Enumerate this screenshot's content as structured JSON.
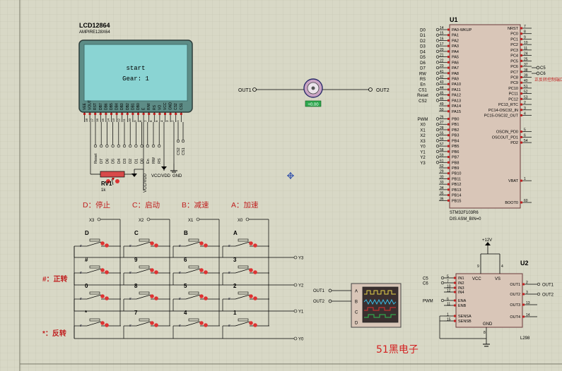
{
  "lcd": {
    "title": "LCD12864",
    "model": "AMPIRE128X64",
    "line1": "start",
    "line2": "Gear: 1",
    "pin_labels": [
      "VEE",
      "VOUT",
      "RST",
      "DB7",
      "DB6",
      "DB5",
      "DB4",
      "DB3",
      "DB2",
      "DB1",
      "DB0",
      "E",
      "R/W",
      "RS",
      "VO",
      "VCC",
      "GND",
      "CS2",
      "CS1"
    ],
    "pin_numbers": [
      "18",
      "17",
      "16",
      "15",
      "14",
      "13",
      "12",
      "11",
      "10",
      "9",
      "8",
      "7",
      "6",
      "5",
      "4",
      "3",
      "2",
      "1"
    ],
    "net_labels": [
      "Reset",
      "D7",
      "D6",
      "D5",
      "D4",
      "D3",
      "D2",
      "D1",
      "D0",
      "En",
      "RW",
      "RS"
    ],
    "cs_labels": [
      "CS2",
      "CS1"
    ],
    "pot_ref": "RV1",
    "pot_value": "1k",
    "power_label": "VCC/VDD",
    "gnd_label": "GND",
    "vcc_label": "VCC/VDD"
  },
  "motor": {
    "left_label": "OUT1",
    "right_label": "OUT2",
    "badge": "+0.00"
  },
  "mcu": {
    "ref": "U1",
    "part": "STM32F103R6",
    "program": "DIS ASM_BIN=0",
    "left_pins": [
      {
        "net": "D0",
        "num": "14",
        "name": "PA0-WKUP"
      },
      {
        "net": "D1",
        "num": "15",
        "name": "PA1"
      },
      {
        "net": "D2",
        "num": "16",
        "name": "PA2"
      },
      {
        "net": "D3",
        "num": "17",
        "name": "PA3"
      },
      {
        "net": "D4",
        "num": "20",
        "name": "PA4"
      },
      {
        "net": "D5",
        "num": "21",
        "name": "PA5"
      },
      {
        "net": "D6",
        "num": "22",
        "name": "PA6"
      },
      {
        "net": "D7",
        "num": "23",
        "name": "PA7"
      },
      {
        "net": "RW",
        "num": "41",
        "name": "PA8"
      },
      {
        "net": "RS",
        "num": "42",
        "name": "PA9"
      },
      {
        "net": "En",
        "num": "43",
        "name": "PA10"
      },
      {
        "net": "CS1",
        "num": "44",
        "name": "PA11"
      },
      {
        "net": "Reset",
        "num": "45",
        "name": "PA12"
      },
      {
        "net": "CS2",
        "num": "46",
        "name": "PA13"
      },
      {
        "net": "",
        "num": "49",
        "name": "PA14"
      },
      {
        "net": "",
        "num": "50",
        "name": "PA15"
      },
      {
        "net": "PWM",
        "num": "26",
        "name": "PB0"
      },
      {
        "net": "X0",
        "num": "27",
        "name": "PB1"
      },
      {
        "net": "X1",
        "num": "28",
        "name": "PB2"
      },
      {
        "net": "X2",
        "num": "55",
        "name": "PB3"
      },
      {
        "net": "X3",
        "num": "56",
        "name": "PB4"
      },
      {
        "net": "Y0",
        "num": "57",
        "name": "PB5"
      },
      {
        "net": "Y1",
        "num": "58",
        "name": "PB6"
      },
      {
        "net": "Y2",
        "num": "59",
        "name": "PB7"
      },
      {
        "net": "Y3",
        "num": "61",
        "name": "PB8"
      },
      {
        "net": "",
        "num": "62",
        "name": "PB9"
      },
      {
        "net": "",
        "num": "29",
        "name": "PB10"
      },
      {
        "net": "",
        "num": "30",
        "name": "PB11"
      },
      {
        "net": "",
        "num": "33",
        "name": "PB12"
      },
      {
        "net": "",
        "num": "34",
        "name": "PB13"
      },
      {
        "net": "",
        "num": "35",
        "name": "PB14"
      },
      {
        "net": "",
        "num": "36",
        "name": "PB15"
      }
    ],
    "right_pins": [
      {
        "name": "NRST",
        "num": "7"
      },
      {
        "name": "PC0",
        "num": "8"
      },
      {
        "name": "PC1",
        "num": "9"
      },
      {
        "name": "PC2",
        "num": "10"
      },
      {
        "name": "PC3",
        "num": "11"
      },
      {
        "name": "PC4",
        "num": "24"
      },
      {
        "name": "PC5",
        "num": "25"
      },
      {
        "name": "PC6",
        "num": "37"
      },
      {
        "name": "PC7",
        "num": "38"
      },
      {
        "name": "PC8",
        "num": "39"
      },
      {
        "name": "PC9",
        "num": "40"
      },
      {
        "name": "PC10",
        "num": "51"
      },
      {
        "name": "PC11",
        "num": "52"
      },
      {
        "name": "PC12",
        "num": "53"
      },
      {
        "name": "PC13_RTC",
        "num": "2"
      },
      {
        "name": "PC14-OSC32_IN",
        "num": "3"
      },
      {
        "name": "PC15-OSC32_OUT",
        "num": "4"
      },
      {
        "name": "OSCIN_PD0",
        "num": "5"
      },
      {
        "name": "OSCOUT_PD1",
        "num": "6"
      },
      {
        "name": "PD2",
        "num": "54"
      },
      {
        "name": "VBAT",
        "num": "1"
      },
      {
        "name": "BOOT0",
        "num": "60"
      }
    ],
    "c5": "C5",
    "c6": "C6",
    "annot": "正反转控制端口"
  },
  "keypad": {
    "headers": [
      "D：停止",
      "C：启动",
      "B：减速",
      "A：加速"
    ],
    "col_labels": [
      "X3",
      "X2",
      "X1",
      "X0"
    ],
    "row_labels": [
      "Y3",
      "Y2",
      "Y1",
      "Y0"
    ],
    "keys": [
      [
        "D",
        "C",
        "B",
        "A"
      ],
      [
        "#",
        "9",
        "6",
        "3"
      ],
      [
        "0",
        "8",
        "5",
        "2"
      ],
      [
        "*",
        "7",
        "4",
        "1"
      ]
    ],
    "hash_note": "#：正转",
    "star_note": "*：反转"
  },
  "scope": {
    "inputs": [
      "OUT1",
      "OUT2"
    ],
    "channels": [
      "A",
      "B",
      "C",
      "D"
    ]
  },
  "driver": {
    "ref": "U2",
    "part": "L298",
    "power": "+12V",
    "vcc_pin": "9",
    "vs_pin": "4",
    "vcc": "VCC",
    "vs": "VS",
    "in_pins": [
      {
        "net": "C5",
        "num": "5",
        "name": "IN1"
      },
      {
        "net": "C6",
        "num": "7",
        "name": "IN2"
      },
      {
        "net": "",
        "num": "10",
        "name": "IN3"
      },
      {
        "net": "",
        "num": "12",
        "name": "IN4"
      },
      {
        "net": "PWM",
        "num": "6",
        "name": "ENA"
      },
      {
        "net": "",
        "num": "11",
        "name": "ENB"
      },
      {
        "net": "",
        "num": "1",
        "name": "SENSA"
      },
      {
        "net": "",
        "num": "15",
        "name": "SENSB"
      }
    ],
    "out_pins": [
      {
        "name": "OUT1",
        "num": "2",
        "net": "OUT1"
      },
      {
        "name": "OUT2",
        "num": "3",
        "net": "OUT2"
      },
      {
        "name": "OUT3",
        "num": "13",
        "net": ""
      },
      {
        "name": "OUT4",
        "num": "14",
        "net": ""
      }
    ],
    "gnd": "GND",
    "gnd_pin": "8"
  },
  "watermark": "51黑电子"
}
